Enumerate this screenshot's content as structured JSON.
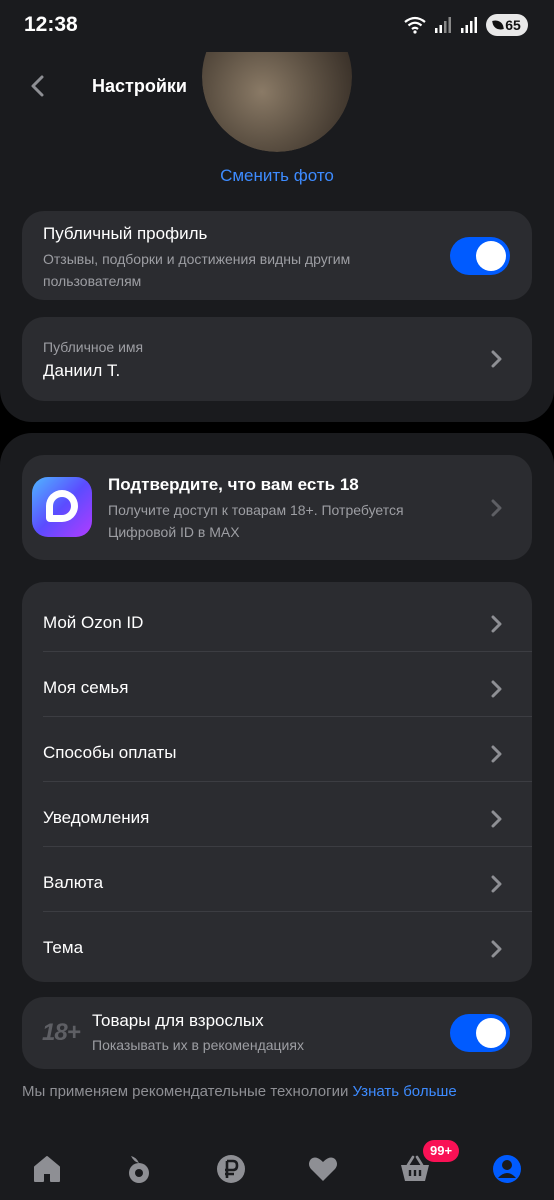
{
  "status_bar": {
    "time": "12:38",
    "battery": "65"
  },
  "header": {
    "title": "Настройки"
  },
  "profile": {
    "change_photo": "Сменить фото"
  },
  "public_profile": {
    "title": "Публичный профиль",
    "subtitle": "Отзывы, подборки и достижения видны другим пользователям",
    "enabled": true
  },
  "public_name": {
    "label": "Публичное имя",
    "value": "Даниил Т."
  },
  "age_verify": {
    "title": "Подтвердите, что вам есть 18",
    "subtitle": "Получите доступ к товарам 18+. Потребуется Цифровой ID в MAX"
  },
  "menu": {
    "items": [
      {
        "label": "Мой Ozon ID"
      },
      {
        "label": "Моя семья"
      },
      {
        "label": "Способы оплаты"
      },
      {
        "label": "Уведомления"
      },
      {
        "label": "Валюта"
      },
      {
        "label": "Тема"
      }
    ]
  },
  "adult_goods": {
    "icon_text": "18+",
    "title": "Товары для взрослых",
    "subtitle": "Показывать их в рекомендациях",
    "enabled": true
  },
  "footer": {
    "note": "Мы применяем рекомендательные технологии",
    "link": "Узнать больше"
  },
  "tabbar": {
    "tabs": [
      "home-icon",
      "fresh-icon",
      "ruble-icon",
      "heart-icon",
      "basket-icon",
      "profile-icon"
    ],
    "cart_badge": "99+",
    "active_color": "#005bff"
  },
  "colors": {
    "accent": "#005bff",
    "link": "#3d8bff",
    "badge": "#f91155"
  }
}
